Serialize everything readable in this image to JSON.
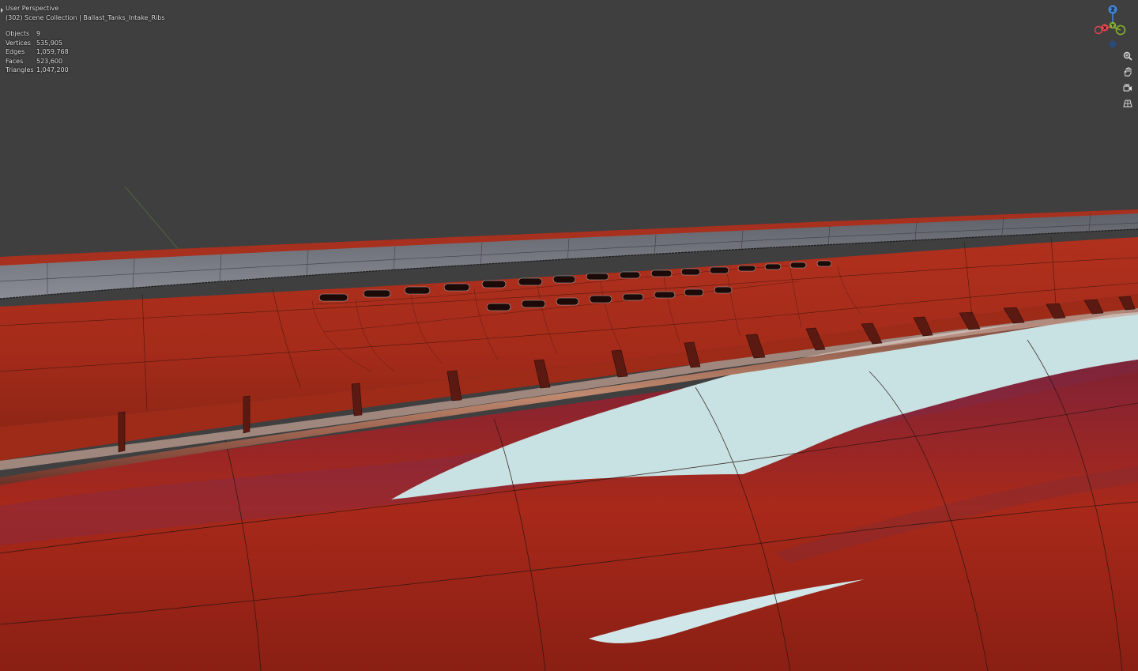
{
  "viewport": {
    "mode_label": "User Perspective",
    "collection_line": "(302) Scene Collection | Ballast_Tanks_Intake_Ribs"
  },
  "stats": [
    {
      "label": "Objects",
      "value": "9"
    },
    {
      "label": "Vertices",
      "value": "535,905"
    },
    {
      "label": "Edges",
      "value": "1,059,768"
    },
    {
      "label": "Faces",
      "value": "523,600"
    },
    {
      "label": "Triangles",
      "value": "1,047,200"
    }
  ],
  "gizmo": {
    "z_label": "Z",
    "y_label": "Y",
    "x_label": "X",
    "colors": {
      "x": "#e8464f",
      "y": "#86b22d",
      "z": "#3e85d6"
    }
  },
  "nav_tools": [
    {
      "name": "zoom-icon"
    },
    {
      "name": "pan-hand-icon"
    },
    {
      "name": "camera-view-icon"
    },
    {
      "name": "perspective-grid-icon"
    }
  ],
  "colors": {
    "background": "#3f3f3f",
    "hull_red": "#a62a1a",
    "deck_grey": "#7d7f88",
    "highlight": "#c6dfe0"
  }
}
